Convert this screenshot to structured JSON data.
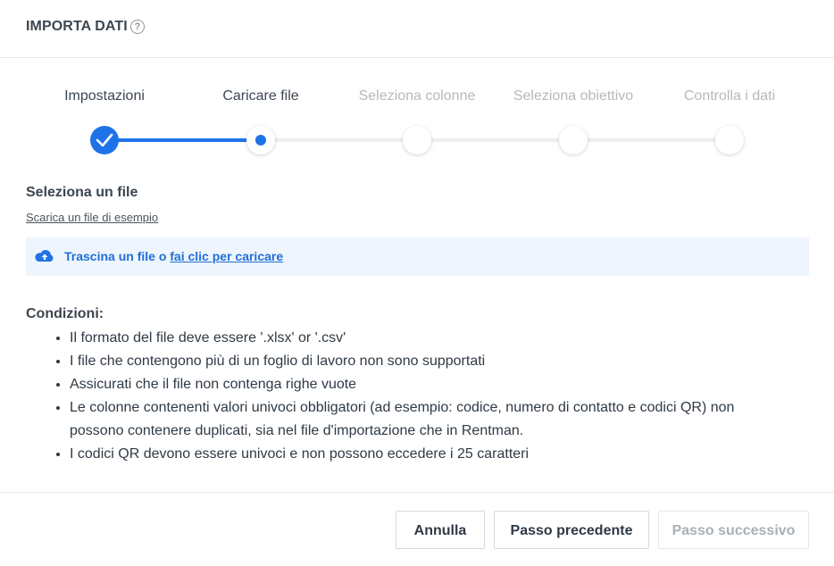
{
  "header": {
    "title": "IMPORTA DATI",
    "help_icon": "question-circle-icon",
    "help_glyph": "?"
  },
  "stepper": {
    "accent_color": "#1f73e8",
    "steps": [
      {
        "label": "Impostazioni",
        "state": "completed"
      },
      {
        "label": "Caricare file",
        "state": "active"
      },
      {
        "label": "Seleziona colonne",
        "state": "pending"
      },
      {
        "label": "Seleziona obiettivo",
        "state": "pending"
      },
      {
        "label": "Controlla i dati",
        "state": "pending"
      }
    ]
  },
  "upload": {
    "section_title": "Seleziona un file",
    "sample_link": "Scarica un file di esempio",
    "icon": "cloud-upload-icon",
    "drop_text": "Trascina un file o",
    "drop_link": "fai clic per caricare"
  },
  "conditions": {
    "title": "Condizioni:",
    "items": [
      "Il formato del file deve essere '.xlsx' or '.csv'",
      "I file che contengono più di un foglio di lavoro non sono supportati",
      "Assicurati che il file non contenga righe vuote",
      "Le colonne contenenti valori univoci obbligatori (ad esempio: codice, numero di contatto e codici QR) non possono contenere duplicati, sia nel file d'importazione che in Rentman.",
      "I codici QR devono essere univoci e non possono eccedere i 25 caratteri"
    ]
  },
  "footer": {
    "cancel_label": "Annulla",
    "previous_label": "Passo precedente",
    "next_label": "Passo successivo",
    "next_disabled": true
  }
}
